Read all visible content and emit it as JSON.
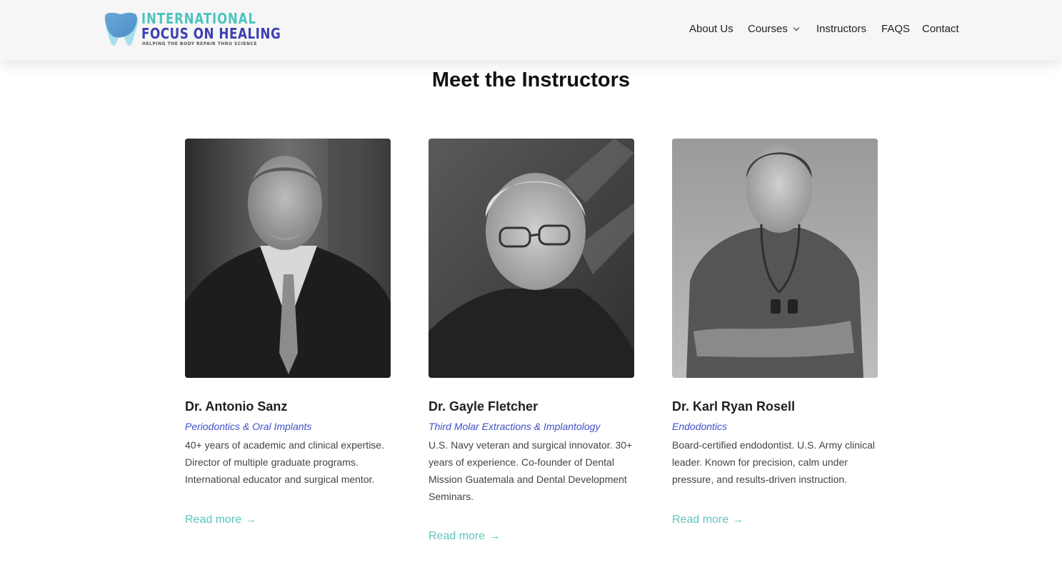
{
  "brand": {
    "line1": "INTERNATIONAL",
    "line2": "FOCUS ON HEALING",
    "tagline": "HELPING THE BODY REPAIR THRU SCIENCE",
    "colors": {
      "teal": "#4cc3bd",
      "indigo": "#3d3fb4",
      "accent_link": "#5ec4bc",
      "specialty": "#4150c8"
    }
  },
  "nav": {
    "items": [
      {
        "label": "About Us"
      },
      {
        "label": "Courses",
        "has_dropdown": true
      },
      {
        "label": "Instructors"
      },
      {
        "label": "FAQS"
      },
      {
        "label": "Contact"
      }
    ]
  },
  "section": {
    "title": "Meet the Instructors"
  },
  "instructors": [
    {
      "name": "Dr. Antonio Sanz",
      "specialty": "Periodontics & Oral Implants",
      "bio": "40+ years of academic and clinical expertise. Director of multiple graduate programs. International educator and surgical mentor.",
      "link": "Read more",
      "link_icon": "arrow-right-icon"
    },
    {
      "name": "Dr. Gayle Fletcher",
      "specialty": "Third Molar Extractions & Implantology",
      "bio": "U.S. Navy veteran and surgical innovator. 30+ years of experience. Co-founder of Dental Mission Guatemala and Dental Development Seminars.",
      "link": "Read more",
      "link_icon": "arrow-right-icon"
    },
    {
      "name": "Dr. Karl Ryan Rosell",
      "specialty": "Endodontics",
      "bio": "Board-certified endodontist. U.S. Army clinical leader. Known for precision, calm under pressure, and results-driven instruction.",
      "link": "Read more",
      "link_icon": "arrow-right-icon"
    }
  ]
}
